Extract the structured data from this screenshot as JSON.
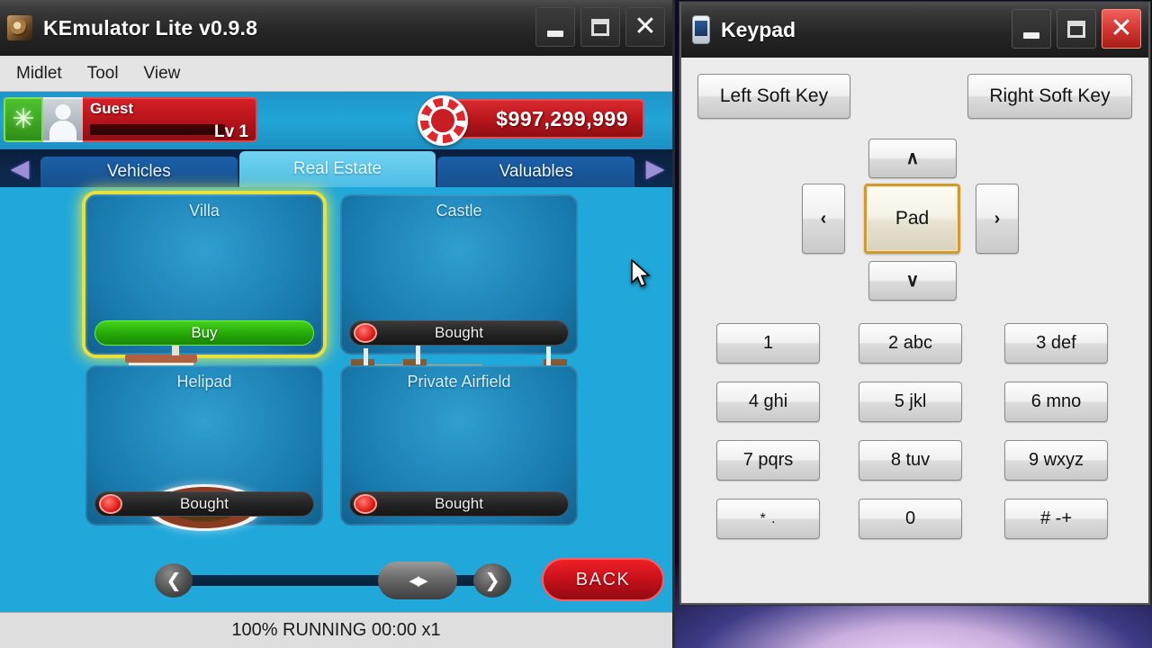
{
  "emulator": {
    "title": "KEmulator Lite v0.9.8",
    "icon": "kemulator-app-icon",
    "window_buttons": {
      "minimize": "_",
      "maximize": "□",
      "close": "✕"
    },
    "menu": [
      "Midlet",
      "Tool",
      "View"
    ],
    "status": "100% RUNNING 00:00 x1"
  },
  "game": {
    "hud": {
      "star_glyph": "✳",
      "player_name": "Guest",
      "level": "Lv 1",
      "money": "$997,299,999",
      "chip_icon": "casino-chip-icon"
    },
    "tabs": {
      "prev_arrow": "◀",
      "next_arrow": "▶",
      "items": [
        {
          "label": "Vehicles",
          "active": false
        },
        {
          "label": "Real Estate",
          "active": true
        },
        {
          "label": "Valuables",
          "active": false
        }
      ]
    },
    "cards": [
      {
        "title": "Villa",
        "action": "Buy",
        "state": "buy",
        "selected": true
      },
      {
        "title": "Castle",
        "action": "Bought",
        "state": "bought",
        "selected": false
      },
      {
        "title": "Helipad",
        "action": "Bought",
        "state": "bought",
        "selected": false
      },
      {
        "title": "Private Airfield",
        "action": "Bought",
        "state": "bought",
        "selected": false
      }
    ],
    "scroller": {
      "left_arrow": "❮",
      "right_arrow": "❯",
      "thumb_glyph": "◀▶"
    },
    "back_button": "BACK"
  },
  "keypad": {
    "title": "Keypad",
    "icon": "phone-icon",
    "window_buttons": {
      "minimize": "_",
      "maximize": "□",
      "close": "✕"
    },
    "soft_keys": {
      "left": "Left Soft Key",
      "right": "Right Soft Key"
    },
    "dpad": {
      "up": "∧",
      "down": "∨",
      "left": "‹",
      "right": "›",
      "center": "Pad",
      "center_focused": true
    },
    "numbers": [
      [
        "1",
        "2 abc",
        "3 def"
      ],
      [
        "4 ghi",
        "5 jkl",
        "6 mno"
      ],
      [
        "7 pqrs",
        "8 tuv",
        "9 wxyz"
      ],
      [
        "* .",
        "0",
        "# -+"
      ]
    ]
  },
  "colors": {
    "titlebar": "#262626",
    "game_bg": "#20a8db",
    "accent_red": "#c5101a",
    "accent_green": "#25a808",
    "tab_active": "#4dbde6",
    "focus_gold": "#d09a30"
  }
}
